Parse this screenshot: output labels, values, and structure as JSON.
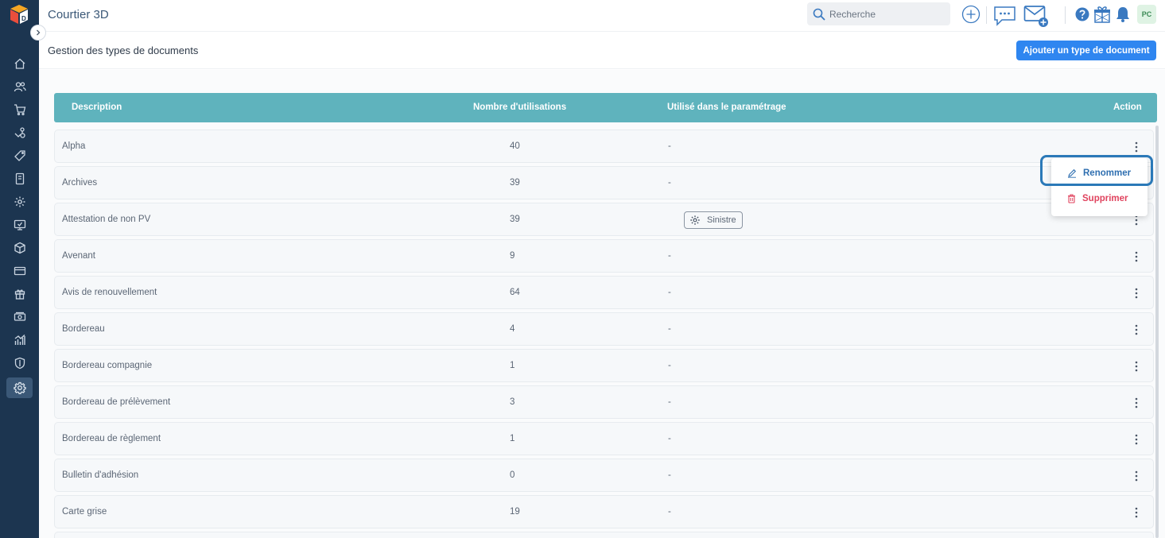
{
  "app": {
    "title": "Courtier 3D"
  },
  "header": {
    "search_placeholder": "Recherche",
    "avatar_initials": "PC"
  },
  "page": {
    "title": "Gestion des types de documents",
    "add_button_label": "Ajouter un type de document"
  },
  "table": {
    "columns": {
      "description": "Description",
      "usage_count": "Nombre d'utilisations",
      "used_in_settings": "Utilisé dans le paramétrage",
      "action": "Action"
    },
    "rows": [
      {
        "description": "Alpha",
        "count": "40",
        "used": "-"
      },
      {
        "description": "Archives",
        "count": "39",
        "used": "-"
      },
      {
        "description": "Attestation de non PV",
        "count": "39",
        "used": "",
        "tag": "Sinistre"
      },
      {
        "description": "Avenant",
        "count": "9",
        "used": "-"
      },
      {
        "description": "Avis de renouvellement",
        "count": "64",
        "used": "-"
      },
      {
        "description": "Bordereau",
        "count": "4",
        "used": "-"
      },
      {
        "description": "Bordereau compagnie",
        "count": "1",
        "used": "-"
      },
      {
        "description": "Bordereau de prélèvement",
        "count": "3",
        "used": "-"
      },
      {
        "description": "Bordereau de règlement",
        "count": "1",
        "used": "-"
      },
      {
        "description": "Bulletin d'adhésion",
        "count": "0",
        "used": "-"
      },
      {
        "description": "Carte grise",
        "count": "19",
        "used": "-"
      }
    ]
  },
  "dropdown": {
    "rename_label": "Renommer",
    "delete_label": "Supprimer"
  },
  "colors": {
    "sidebar": "#1c3550",
    "table_header": "#5fb3bd",
    "primary": "#2f86f0",
    "danger": "#e0435e"
  }
}
